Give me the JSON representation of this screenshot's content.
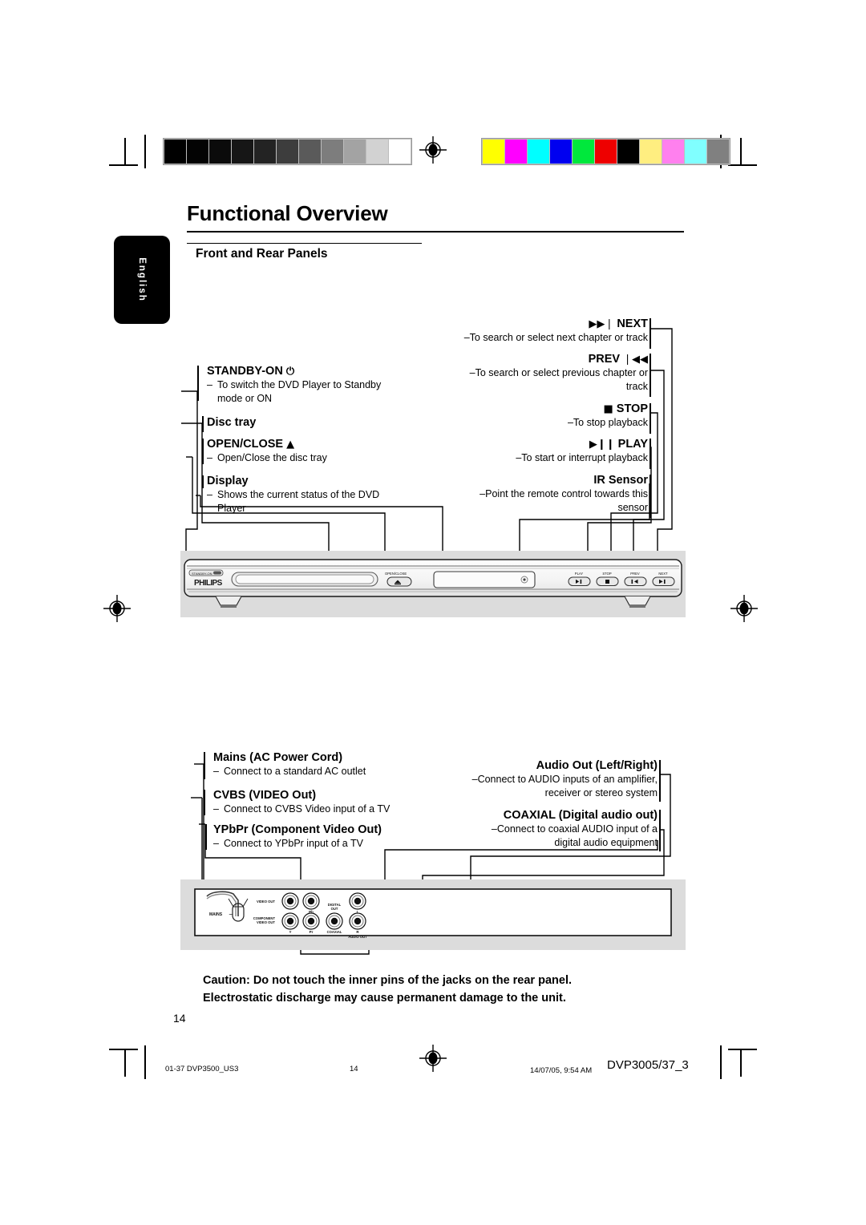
{
  "page": {
    "title": "Functional Overview",
    "subtitle": "Front and Rear Panels",
    "language_tab": "English",
    "page_number": "14",
    "caution_line1": "Caution: Do not touch the inner pins of the jacks on the rear panel.",
    "caution_line2": "Electrostatic discharge may cause permanent damage to the unit."
  },
  "footer": {
    "left": "01-37 DVP3500_US3",
    "center": "14",
    "date": "14/07/05, 9:54 AM",
    "model": "DVP3005/37_3"
  },
  "calibration": {
    "gray_bar": [
      "#000000",
      "#030303",
      "#0b0b0b",
      "#161616",
      "#232323",
      "#3d3d3d",
      "#5a5a5a",
      "#7d7d7d",
      "#a3a3a3",
      "#d2d2d2",
      "#ffffff"
    ],
    "color_bar": [
      "#ffff00",
      "#ff00ff",
      "#00ffff",
      "#0000f0",
      "#00e83c",
      "#ee0000",
      "#000000",
      "#ffee80",
      "#ff80ee",
      "#80ffff",
      "#808080"
    ]
  },
  "front_panel_callouts": {
    "left": [
      {
        "heading": "STANDBY-ON",
        "icon": "power-icon",
        "icon_glyph": "⏻",
        "lines": [
          "To switch the DVD Player to Standby",
          "mode or ON"
        ]
      },
      {
        "heading": "Disc tray",
        "icon": "",
        "icon_glyph": "",
        "lines": []
      },
      {
        "heading": "OPEN/CLOSE",
        "icon": "eject-icon",
        "icon_glyph": "▲",
        "lines": [
          "Open/Close the disc tray"
        ]
      },
      {
        "heading": "Display",
        "icon": "",
        "icon_glyph": "",
        "lines": [
          "Shows the current status of the DVD",
          "Player"
        ]
      }
    ],
    "right": [
      {
        "heading": "NEXT",
        "icon": "next-icon",
        "icon_glyph": "▶▶❘",
        "icon_side": "before",
        "lines": [
          "To search or select next chapter or track"
        ]
      },
      {
        "heading": "PREV",
        "icon": "prev-icon",
        "icon_glyph": "❘◀◀",
        "icon_side": "after",
        "lines": [
          "To search or select previous chapter or",
          "track"
        ]
      },
      {
        "heading": "STOP",
        "icon": "stop-icon",
        "icon_glyph": "■",
        "icon_side": "before",
        "lines": [
          "To stop playback"
        ]
      },
      {
        "heading": "PLAY",
        "icon": "play-pause-icon",
        "icon_glyph": "▶❙❙",
        "icon_side": "before",
        "lines": [
          "To start or interrupt playback"
        ]
      },
      {
        "heading": "IR Sensor",
        "icon": "",
        "icon_glyph": "",
        "icon_side": "before",
        "lines": [
          "Point the remote control towards this",
          "sensor"
        ]
      }
    ]
  },
  "rear_panel_callouts": {
    "left": [
      {
        "heading": "Mains (AC Power Cord)",
        "lines": [
          "Connect to a standard AC outlet"
        ]
      },
      {
        "heading": "CVBS (VIDEO Out)",
        "lines": [
          "Connect to CVBS Video input of a TV"
        ]
      },
      {
        "heading": "YPbPr (Component Video Out)",
        "lines": [
          "Connect to YPbPr input of a TV"
        ]
      }
    ],
    "right": [
      {
        "heading": "Audio Out (Left/Right)",
        "lines": [
          "Connect to AUDIO inputs of an amplifier,",
          "receiver or stereo system"
        ]
      },
      {
        "heading": "COAXIAL (Digital audio out)",
        "lines": [
          "Connect to coaxial AUDIO input of a",
          "digital audio equipment"
        ]
      }
    ]
  },
  "front_device": {
    "brand": "PHILIPS",
    "standby_label": "STANDBY-ON",
    "open_close_label": "OPEN/CLOSE",
    "buttons": [
      "PLAY",
      "STOP",
      "PREV",
      "NEXT"
    ]
  },
  "rear_device": {
    "mains_label": "MAINS",
    "jacks": [
      {
        "label": "VIDEO OUT",
        "sub": ""
      },
      {
        "label": "COMPONENT VIDEO OUT",
        "sub": ""
      },
      {
        "label": "Y",
        "sub": ""
      },
      {
        "label": "Pb",
        "sub": ""
      },
      {
        "label": "Pr",
        "sub": ""
      },
      {
        "label": "DIGITAL OUT",
        "sub": ""
      },
      {
        "label": "COAXIAL",
        "sub": ""
      },
      {
        "label": "AUDIO OUT",
        "sub": ""
      },
      {
        "label": "L",
        "sub": ""
      },
      {
        "label": "R",
        "sub": ""
      }
    ]
  }
}
